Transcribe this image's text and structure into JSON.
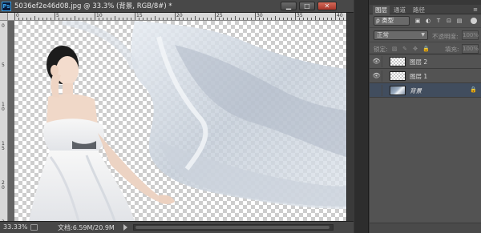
{
  "document": {
    "app_icon": "Ps",
    "title": "5036ef2e46d08.jpg @ 33.3% (背景, RGB/8#) *",
    "window_buttons": {
      "minimize": "▁",
      "maximize": "□",
      "close": "✕"
    },
    "ruler_h_labels": [
      "0",
      "5",
      "10",
      "15",
      "20",
      "25",
      "30",
      "35",
      "40"
    ],
    "ruler_v_labels": [
      "0",
      "5",
      "10",
      "15",
      "20",
      "25"
    ],
    "status": {
      "zoom": "33.33%",
      "doc_size": "文档:6.59M/20.9M"
    }
  },
  "layers_panel": {
    "tabs": [
      {
        "label": "图层",
        "active": true
      },
      {
        "label": "通道",
        "active": false
      },
      {
        "label": "路径",
        "active": false
      }
    ],
    "menu_icon": "≡",
    "kind_filter": "ρ 类型",
    "filter_icons": [
      "▣",
      "◐",
      "T",
      "⊡",
      "▤"
    ],
    "blend_mode": "正常",
    "opacity_label": "不透明度:",
    "opacity_value": "100%",
    "lock_label": "锁定:",
    "lock_icons": [
      "▧",
      "✎",
      "✥",
      "🔒"
    ],
    "fill_label": "填充:",
    "fill_value": "100%",
    "layers": [
      {
        "name": "图层 2",
        "visible": true,
        "selected": false,
        "locked": false,
        "thumb": "transparent"
      },
      {
        "name": "图层 1",
        "visible": true,
        "selected": false,
        "locked": false,
        "thumb": "transparent"
      },
      {
        "name": "背景",
        "visible": false,
        "selected": true,
        "locked": true,
        "thumb": "photo"
      }
    ]
  },
  "colors": {
    "ui_dark": "#282828",
    "panel_bg": "#535353",
    "selected_layer": "#414d5e",
    "ps_blue": "#39a0e6"
  }
}
